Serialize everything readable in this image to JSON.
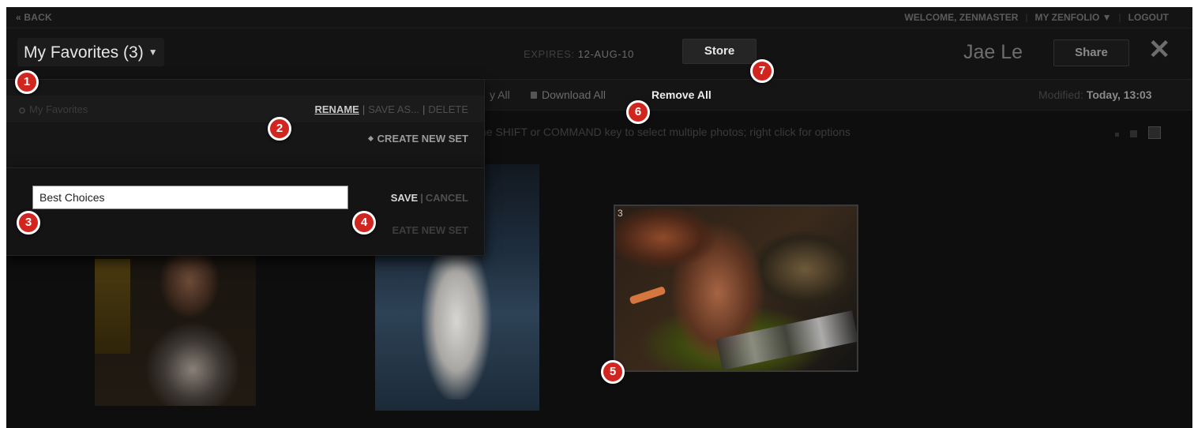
{
  "topbar": {
    "back": "« BACK",
    "welcome": "WELCOME, ZENMASTER",
    "my_zenfolio": "MY ZENFOLIO",
    "logout": "LOGOUT"
  },
  "header": {
    "title": "My Favorites (3)",
    "expires_label": "EXPIRES:",
    "expires_value": "12-AUG-10",
    "store": "Store",
    "owner": "Jae Le",
    "share": "Share"
  },
  "toolbar": {
    "view_all_partial": "y All",
    "download_all": "Download All",
    "remove_all": "Remove All",
    "modified_label": "Modified:",
    "modified_value": "Today, 13:03"
  },
  "hint": "he SHIFT or COMMAND key to select multiple photos; right click for options",
  "dropdown": {
    "set_name": "My Favorites",
    "rename": "RENAME",
    "save_as": "SAVE AS...",
    "delete": "DELETE",
    "create_new_set": "CREATE NEW SET"
  },
  "rename_panel": {
    "input_value": "Best Choices",
    "save": "SAVE",
    "cancel": "CANCEL",
    "create_partial": "EATE NEW SET"
  },
  "photos": [
    {
      "number": "3"
    }
  ],
  "callouts": [
    "1",
    "2",
    "3",
    "4",
    "5",
    "6",
    "7"
  ],
  "colors": {
    "callout": "#d0261f",
    "background": "#0e0e0e"
  }
}
